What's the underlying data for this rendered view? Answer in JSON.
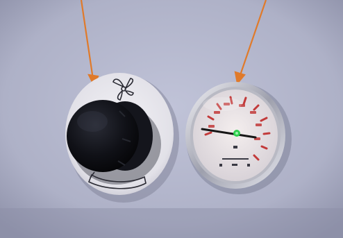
{
  "photo": {
    "description_free": true,
    "colors": {
      "panel": "#b3b6cc",
      "panel_dark": "#8d90a8",
      "arrow": "#e07a2a",
      "knob": "#0c0d12",
      "dial_face": "#ece6e6",
      "gauge_ticks": "#c23a3a",
      "needle": "#1a1a1a",
      "pivot": "#2fd04f"
    },
    "icons": [
      "arrow-icon",
      "arrow-icon",
      "fan-icon"
    ]
  }
}
